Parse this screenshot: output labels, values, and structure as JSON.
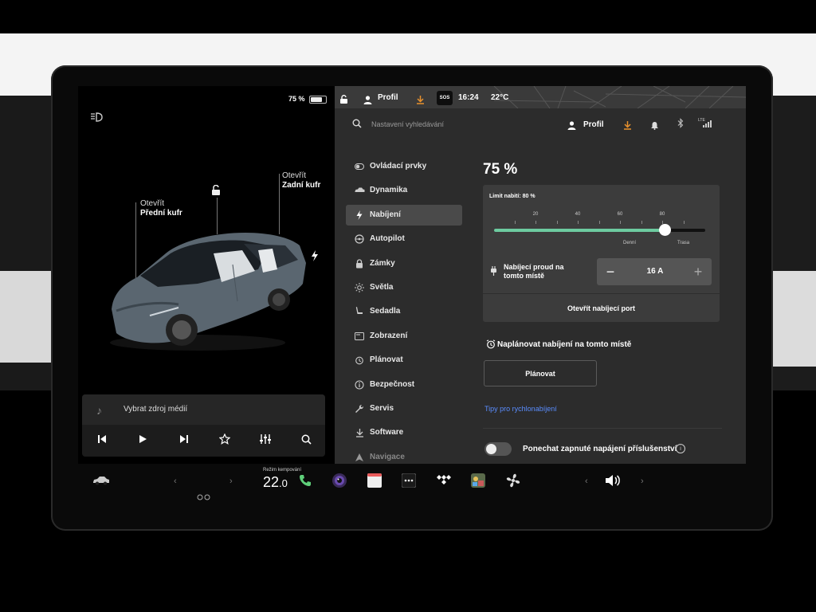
{
  "status_bar": {
    "battery_percent": "75 %",
    "battery_level": 0.75,
    "profile_label": "Profil",
    "sos_label": "SOS",
    "time": "16:24",
    "temperature": "22°C"
  },
  "car_view": {
    "front_trunk": {
      "action": "Otevřít",
      "label": "Přední kufr"
    },
    "rear_trunk": {
      "action": "Otevřít",
      "label": "Zadní kufr"
    }
  },
  "media": {
    "source_label": "Vybrat zdroj médií"
  },
  "search": {
    "placeholder": "Nastavení vyhledávání",
    "profile_label": "Profil"
  },
  "nav": {
    "items": [
      {
        "label": "Ovládací prvky",
        "icon": "toggle-icon"
      },
      {
        "label": "Dynamika",
        "icon": "car-icon"
      },
      {
        "label": "Nabíjení",
        "icon": "bolt-icon",
        "active": true
      },
      {
        "label": "Autopilot",
        "icon": "steering-wheel-icon"
      },
      {
        "label": "Zámky",
        "icon": "lock-icon"
      },
      {
        "label": "Světla",
        "icon": "sun-icon"
      },
      {
        "label": "Sedadla",
        "icon": "seat-icon"
      },
      {
        "label": "Zobrazení",
        "icon": "display-icon"
      },
      {
        "label": "Plánovat",
        "icon": "alarm-icon"
      },
      {
        "label": "Bezpečnost",
        "icon": "info-circle-icon"
      },
      {
        "label": "Servis",
        "icon": "wrench-icon"
      },
      {
        "label": "Software",
        "icon": "download-icon"
      },
      {
        "label": "Navigace",
        "icon": "navigation-icon"
      }
    ]
  },
  "charging": {
    "percent": "75 %",
    "limit_label": "Limit nabití: 80 %",
    "limit_value": 80,
    "ticks": [
      "20",
      "40",
      "60",
      "80"
    ],
    "daily_label": "Denní",
    "trip_label": "Trasa",
    "current_label": "Nabíjecí proud na tomto místě",
    "current_value": "16 A",
    "minus_label": "−",
    "plus_label": "+",
    "open_port_label": "Otevřít nabíjecí port",
    "schedule_label": "Naplánovat nabíjení na tomto místě",
    "plan_button": "Plánovat",
    "tips_link": "Tipy pro rychlonabíjení",
    "accessory_power_label": "Ponechat zapnuté napájení příslušenství",
    "accessory_power_on": false
  },
  "bottom_bar": {
    "climate_mode": "Režim kempování",
    "temperature": "22",
    "temperature_decimal": ".0"
  },
  "colors": {
    "accent_green": "#6dcba0",
    "link_blue": "#5a8dff",
    "download_orange": "#e8912d"
  }
}
